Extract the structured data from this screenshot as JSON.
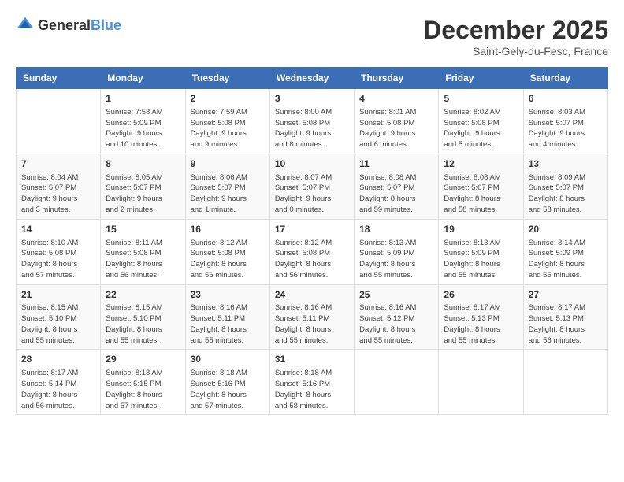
{
  "header": {
    "logo_general": "General",
    "logo_blue": "Blue",
    "month_title": "December 2025",
    "location": "Saint-Gely-du-Fesc, France"
  },
  "calendar": {
    "days_of_week": [
      "Sunday",
      "Monday",
      "Tuesday",
      "Wednesday",
      "Thursday",
      "Friday",
      "Saturday"
    ],
    "weeks": [
      [
        {
          "day": "",
          "info": ""
        },
        {
          "day": "1",
          "info": "Sunrise: 7:58 AM\nSunset: 5:09 PM\nDaylight: 9 hours\nand 10 minutes."
        },
        {
          "day": "2",
          "info": "Sunrise: 7:59 AM\nSunset: 5:08 PM\nDaylight: 9 hours\nand 9 minutes."
        },
        {
          "day": "3",
          "info": "Sunrise: 8:00 AM\nSunset: 5:08 PM\nDaylight: 9 hours\nand 8 minutes."
        },
        {
          "day": "4",
          "info": "Sunrise: 8:01 AM\nSunset: 5:08 PM\nDaylight: 9 hours\nand 6 minutes."
        },
        {
          "day": "5",
          "info": "Sunrise: 8:02 AM\nSunset: 5:08 PM\nDaylight: 9 hours\nand 5 minutes."
        },
        {
          "day": "6",
          "info": "Sunrise: 8:03 AM\nSunset: 5:07 PM\nDaylight: 9 hours\nand 4 minutes."
        }
      ],
      [
        {
          "day": "7",
          "info": "Sunrise: 8:04 AM\nSunset: 5:07 PM\nDaylight: 9 hours\nand 3 minutes."
        },
        {
          "day": "8",
          "info": "Sunrise: 8:05 AM\nSunset: 5:07 PM\nDaylight: 9 hours\nand 2 minutes."
        },
        {
          "day": "9",
          "info": "Sunrise: 8:06 AM\nSunset: 5:07 PM\nDaylight: 9 hours\nand 1 minute."
        },
        {
          "day": "10",
          "info": "Sunrise: 8:07 AM\nSunset: 5:07 PM\nDaylight: 9 hours\nand 0 minutes."
        },
        {
          "day": "11",
          "info": "Sunrise: 8:08 AM\nSunset: 5:07 PM\nDaylight: 8 hours\nand 59 minutes."
        },
        {
          "day": "12",
          "info": "Sunrise: 8:08 AM\nSunset: 5:07 PM\nDaylight: 8 hours\nand 58 minutes."
        },
        {
          "day": "13",
          "info": "Sunrise: 8:09 AM\nSunset: 5:07 PM\nDaylight: 8 hours\nand 58 minutes."
        }
      ],
      [
        {
          "day": "14",
          "info": "Sunrise: 8:10 AM\nSunset: 5:08 PM\nDaylight: 8 hours\nand 57 minutes."
        },
        {
          "day": "15",
          "info": "Sunrise: 8:11 AM\nSunset: 5:08 PM\nDaylight: 8 hours\nand 56 minutes."
        },
        {
          "day": "16",
          "info": "Sunrise: 8:12 AM\nSunset: 5:08 PM\nDaylight: 8 hours\nand 56 minutes."
        },
        {
          "day": "17",
          "info": "Sunrise: 8:12 AM\nSunset: 5:08 PM\nDaylight: 8 hours\nand 56 minutes."
        },
        {
          "day": "18",
          "info": "Sunrise: 8:13 AM\nSunset: 5:09 PM\nDaylight: 8 hours\nand 55 minutes."
        },
        {
          "day": "19",
          "info": "Sunrise: 8:13 AM\nSunset: 5:09 PM\nDaylight: 8 hours\nand 55 minutes."
        },
        {
          "day": "20",
          "info": "Sunrise: 8:14 AM\nSunset: 5:09 PM\nDaylight: 8 hours\nand 55 minutes."
        }
      ],
      [
        {
          "day": "21",
          "info": "Sunrise: 8:15 AM\nSunset: 5:10 PM\nDaylight: 8 hours\nand 55 minutes."
        },
        {
          "day": "22",
          "info": "Sunrise: 8:15 AM\nSunset: 5:10 PM\nDaylight: 8 hours\nand 55 minutes."
        },
        {
          "day": "23",
          "info": "Sunrise: 8:16 AM\nSunset: 5:11 PM\nDaylight: 8 hours\nand 55 minutes."
        },
        {
          "day": "24",
          "info": "Sunrise: 8:16 AM\nSunset: 5:11 PM\nDaylight: 8 hours\nand 55 minutes."
        },
        {
          "day": "25",
          "info": "Sunrise: 8:16 AM\nSunset: 5:12 PM\nDaylight: 8 hours\nand 55 minutes."
        },
        {
          "day": "26",
          "info": "Sunrise: 8:17 AM\nSunset: 5:13 PM\nDaylight: 8 hours\nand 55 minutes."
        },
        {
          "day": "27",
          "info": "Sunrise: 8:17 AM\nSunset: 5:13 PM\nDaylight: 8 hours\nand 56 minutes."
        }
      ],
      [
        {
          "day": "28",
          "info": "Sunrise: 8:17 AM\nSunset: 5:14 PM\nDaylight: 8 hours\nand 56 minutes."
        },
        {
          "day": "29",
          "info": "Sunrise: 8:18 AM\nSunset: 5:15 PM\nDaylight: 8 hours\nand 57 minutes."
        },
        {
          "day": "30",
          "info": "Sunrise: 8:18 AM\nSunset: 5:16 PM\nDaylight: 8 hours\nand 57 minutes."
        },
        {
          "day": "31",
          "info": "Sunrise: 8:18 AM\nSunset: 5:16 PM\nDaylight: 8 hours\nand 58 minutes."
        },
        {
          "day": "",
          "info": ""
        },
        {
          "day": "",
          "info": ""
        },
        {
          "day": "",
          "info": ""
        }
      ]
    ]
  }
}
